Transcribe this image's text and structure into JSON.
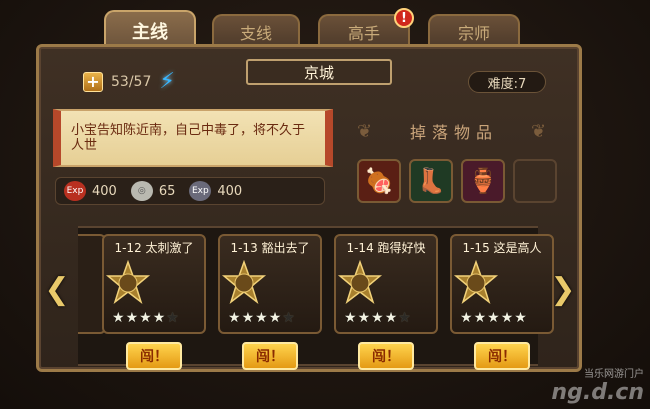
{
  "tabs": [
    {
      "label": "主线",
      "active": true
    },
    {
      "label": "支线",
      "active": false
    },
    {
      "label": "高手",
      "active": false,
      "badge": "!"
    },
    {
      "label": "宗师",
      "active": false
    }
  ],
  "energy": {
    "plus_label": "+",
    "value": "53/57",
    "icon": "lightning-icon"
  },
  "city": {
    "name": "京城"
  },
  "difficulty": {
    "label": "难度:7"
  },
  "story": {
    "text": "小宝告知陈近南，自己中毒了，将不久于人世"
  },
  "drops": {
    "title": "掉落物品",
    "items": [
      {
        "icon": "meat-icon",
        "glyph": "🍖"
      },
      {
        "icon": "green-boot-icon",
        "glyph": "👢"
      },
      {
        "icon": "wine-jar-icon",
        "glyph": "🏺"
      },
      {
        "icon": "empty-slot",
        "glyph": ""
      }
    ]
  },
  "rewards": [
    {
      "icon": "exp-icon",
      "value": "400"
    },
    {
      "icon": "silver-coin-icon",
      "value": "65"
    },
    {
      "icon": "exp-icon",
      "value": "400"
    }
  ],
  "levels": [
    {
      "name": "1-12 太刺激了",
      "stars_earned": 4,
      "stars_total": 5,
      "button": "闯！"
    },
    {
      "name": "1-13 豁出去了",
      "stars_earned": 4,
      "stars_total": 5,
      "button": "闯！"
    },
    {
      "name": "1-14 跑得好快",
      "stars_earned": 4,
      "stars_total": 5,
      "button": "闯！"
    },
    {
      "name": "1-15 这是高人",
      "stars_earned": 5,
      "stars_total": 5,
      "button": "闯！"
    }
  ],
  "watermark": {
    "line1": "当乐网游门户",
    "line2": "ng.d.cn"
  }
}
